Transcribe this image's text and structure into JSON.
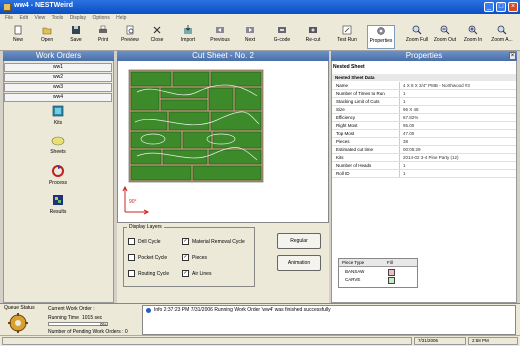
{
  "window": {
    "title": "ww4 - NESTWeird"
  },
  "menu": [
    "File",
    "Edit",
    "View",
    "Tools",
    "Display",
    "Options",
    "Help"
  ],
  "toolbar": [
    {
      "label": "New",
      "icon": "new-doc-icon"
    },
    {
      "label": "Open",
      "icon": "open-folder-icon"
    },
    {
      "label": "Save",
      "icon": "save-icon"
    },
    {
      "label": "Print",
      "icon": "print-icon"
    },
    {
      "label": "Preview",
      "icon": "preview-icon"
    },
    {
      "label": "Close",
      "icon": "close-doc-icon"
    },
    {
      "label": "Import",
      "icon": "import-icon"
    },
    {
      "label": "Previous",
      "icon": "previous-icon"
    },
    {
      "label": "Next",
      "icon": "next-icon"
    },
    {
      "label": "G-code",
      "icon": "gcode-icon"
    },
    {
      "label": "Re-cut",
      "icon": "recut-icon"
    },
    {
      "label": "Test Run",
      "icon": "test-run-icon"
    },
    {
      "label": "Properties",
      "icon": "properties-icon"
    },
    {
      "label": "Zoom Full",
      "icon": "zoom-full-icon"
    },
    {
      "label": "Zoom Out",
      "icon": "zoom-out-icon"
    },
    {
      "label": "Zoom In",
      "icon": "zoom-in-icon"
    },
    {
      "label": "Zoom A...",
      "icon": "zoom-area-icon"
    }
  ],
  "work_orders": {
    "title": "Work Orders",
    "items": [
      "ww1",
      "ww2",
      "ww3",
      "ww4"
    ],
    "nav": [
      {
        "label": "Kits",
        "icon": "kits-icon"
      },
      {
        "label": "Sheets",
        "icon": "sheets-icon"
      },
      {
        "label": "Process",
        "icon": "process-icon"
      },
      {
        "label": "Results",
        "icon": "results-icon"
      }
    ]
  },
  "cut_sheet": {
    "title": "Cut Sheet - No. 2",
    "origin_label": "90°"
  },
  "display_layers": {
    "title": "Display Layers",
    "options": [
      {
        "label": "Drill Cycle",
        "checked": false
      },
      {
        "label": "Pocket Cycle",
        "checked": false
      },
      {
        "label": "Routing Cycle",
        "checked": false
      },
      {
        "label": "Material Removal Cycle",
        "checked": true
      },
      {
        "label": "Pieces",
        "checked": true
      },
      {
        "label": "Air Lines",
        "checked": true
      }
    ],
    "regular_label": "Regular",
    "animation_label": "Animation"
  },
  "properties": {
    "title": "Properties",
    "section_label": "Nested Sheet",
    "group_label": "Nested Sheet Data",
    "rows": [
      {
        "key": "Name",
        "value": "4 X 8 X 3/4\" PMB - Northwood #3"
      },
      {
        "key": "Number of Times to Run",
        "value": "1"
      },
      {
        "key": "Stacking Limit of Cuts",
        "value": "1"
      },
      {
        "key": "Size",
        "value": "96 X 48"
      },
      {
        "key": "Efficiency",
        "value": "67.82%"
      },
      {
        "key": "Right Most",
        "value": "95.00"
      },
      {
        "key": "Top Most",
        "value": "47.00"
      },
      {
        "key": "Pieces",
        "value": "38"
      },
      {
        "key": "Estimated cut time",
        "value": "00:05:29"
      },
      {
        "key": "Kits",
        "value": "2014-02 3-4 Pine Party (12)"
      },
      {
        "key": "Number of Heads",
        "value": "1"
      },
      {
        "key": "Roll ID",
        "value": "1"
      }
    ],
    "piece_table": {
      "headers": [
        "Piece Type",
        "Fill"
      ],
      "rows": [
        {
          "type": "BANSAW",
          "fill": "#f0c0c0"
        },
        {
          "type": "CARVE",
          "fill": "#c0f0c0"
        }
      ]
    }
  },
  "queue": {
    "title": "Queue Status",
    "current_label": "Current Work Order :",
    "running_label": "Running Time",
    "running_value": "1015 sec",
    "progress_text": "0%",
    "progress": 0,
    "pending_label": "Number of Pending Work Orders : 0",
    "log": "Info  2:37:23 PM  7/31/2006  Running Work Order 'ww4' was finished successfully"
  },
  "status": {
    "date": "7/31/2006",
    "time": "2:58 PM"
  },
  "colors": {
    "panel_head": "#4a6fa8",
    "sheet_green": "#3c8a2a",
    "sheet_tan": "#b09a70",
    "title_blue": "#0a4fc4"
  }
}
